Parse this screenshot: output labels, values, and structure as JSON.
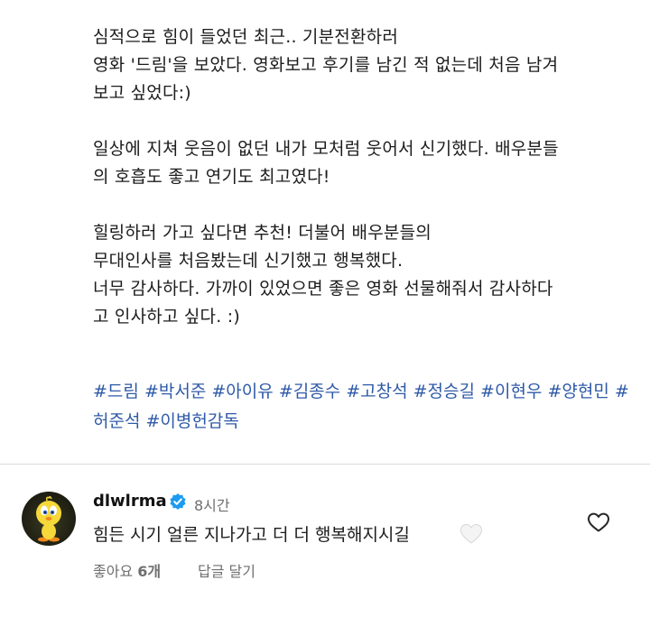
{
  "post": {
    "caption_lines": [
      "심적으로 힘이 들었던 최근.. 기분전환하러",
      "영화 '드림'을 보았다. 영화보고 후기를 남긴 적 없는데 처음 남겨",
      "보고 싶었다:)",
      "",
      "일상에 지쳐 웃음이 없던 내가 모처럼 웃어서 신기했다. 배우분들",
      "의 호흡도 좋고 연기도 최고였다!",
      "",
      "힐링하러 가고 싶다면 추천! 더불어 배우분들의",
      "무대인사를 처음봤는데 신기했고 행복했다.",
      "너무 감사하다.  가까이 있었으면 좋은 영화 선물해줘서 감사하다",
      "고 인사하고 싶다. :)"
    ],
    "hashtags": [
      "#드림",
      "#박서준",
      "#아이유",
      "#김종수",
      "#고창석",
      "#정승길",
      "#이현우",
      "#양현민",
      "#허준석",
      "#이병헌감독"
    ]
  },
  "comment": {
    "username": "dlwlrma",
    "time": "8시간",
    "text": "힘든 시기 얼른 지나가고 더 더 행복해지시길",
    "likes_label": "좋아요",
    "likes_count": "6개",
    "reply_label": "답글 달기",
    "avatar_icon": "tweety-bird-avatar",
    "verified_icon": "verified-badge-icon",
    "emoji_icon": "white-heart-icon",
    "like_icon": "heart-outline-icon"
  },
  "colors": {
    "hashtag": "#2f5aa8",
    "verified": "#1d9bf0",
    "meta_text": "#6f6f6f",
    "divider": "#dbdbdb"
  }
}
